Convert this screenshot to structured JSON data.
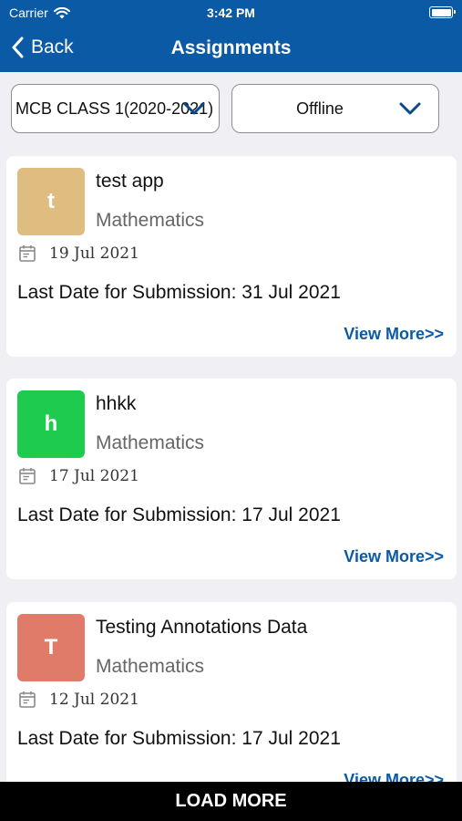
{
  "status_bar": {
    "carrier": "Carrier",
    "time": "3:42 PM",
    "battery_level": 1.0
  },
  "nav": {
    "back_label": "Back",
    "title": "Assignments"
  },
  "filters": {
    "class_value": "MCB CLASS 1(2020-2021)",
    "mode_value": "Offline"
  },
  "assignments": [
    {
      "initial": "t",
      "color": "#dfbd80",
      "title": "test app",
      "subject": "Mathematics",
      "date": "19 Jul 2021",
      "last_date": "Last Date for Submission: 31 Jul 2021",
      "view_more": "View More>>"
    },
    {
      "initial": "h",
      "color": "#1ecb4f",
      "title": "hhkk",
      "subject": "Mathematics",
      "date": "17 Jul 2021",
      "last_date": "Last Date for Submission: 17 Jul 2021",
      "view_more": "View More>>"
    },
    {
      "initial": "T",
      "color": "#e07b6a",
      "title": "Testing Annotations Data",
      "subject": "Mathematics",
      "date": "12 Jul 2021",
      "last_date": "Last Date for Submission: 17 Jul 2021",
      "view_more": "View More>>"
    }
  ],
  "load_more_label": "LOAD MORE",
  "colors": {
    "nav_bar": "#0b5aa5",
    "link": "#0b5aa5",
    "background": "#efeff4"
  },
  "icons": {
    "back": "chevron-left-icon",
    "dropdown": "chevron-down-icon",
    "date": "calendar-icon",
    "wifi": "wifi-icon"
  }
}
